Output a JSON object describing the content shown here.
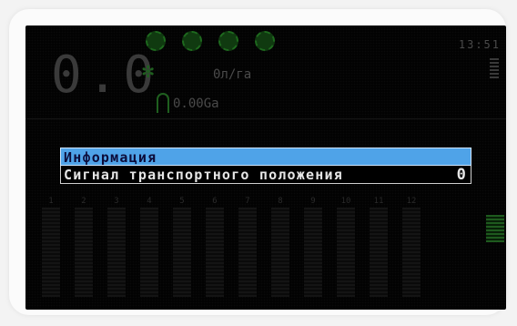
{
  "status": {
    "speed": "0.0",
    "rate": "0л/га",
    "area": "0.00Ga",
    "clock": "13:51"
  },
  "section_columns": [
    "1",
    "2",
    "3",
    "4",
    "5",
    "6",
    "7",
    "8",
    "9",
    "10",
    "11",
    "12"
  ],
  "menu": {
    "items": [
      {
        "label": "Информация",
        "selected": true
      },
      {
        "label": "Сигнал транспортного положения",
        "value": "0"
      }
    ]
  },
  "colors": {
    "menu_highlight": "#4fa3e8",
    "screen_bg": "#000000"
  }
}
